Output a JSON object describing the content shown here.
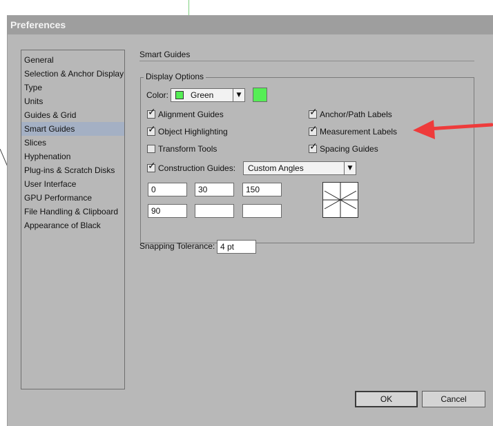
{
  "window": {
    "title": "Preferences"
  },
  "sidebar": {
    "items": [
      {
        "label": "General"
      },
      {
        "label": "Selection & Anchor Display"
      },
      {
        "label": "Type"
      },
      {
        "label": "Units"
      },
      {
        "label": "Guides & Grid"
      },
      {
        "label": "Smart Guides",
        "selected": true
      },
      {
        "label": "Slices"
      },
      {
        "label": "Hyphenation"
      },
      {
        "label": "Plug-ins & Scratch Disks"
      },
      {
        "label": "User Interface"
      },
      {
        "label": "GPU Performance"
      },
      {
        "label": "File Handling & Clipboard"
      },
      {
        "label": "Appearance of Black"
      }
    ]
  },
  "main": {
    "section_title": "Smart Guides",
    "display_options": {
      "legend": "Display Options",
      "color_label": "Color:",
      "color_value": "Green",
      "color_hex": "#55ee55",
      "checkboxes": {
        "alignment_guides": {
          "label": "Alignment Guides",
          "checked": true
        },
        "object_highlighting": {
          "label": "Object Highlighting",
          "checked": true
        },
        "transform_tools": {
          "label": "Transform Tools",
          "checked": false
        },
        "anchor_path_labels": {
          "label": "Anchor/Path Labels",
          "checked": true
        },
        "measurement_labels": {
          "label": "Measurement Labels",
          "checked": true
        },
        "spacing_guides": {
          "label": "Spacing Guides",
          "checked": true
        },
        "construction_guides": {
          "label": "Construction Guides:",
          "checked": true
        }
      },
      "construction_select_value": "Custom Angles",
      "angles": [
        "0",
        "30",
        "150",
        "90",
        "",
        ""
      ]
    },
    "snapping_tolerance": {
      "label": "Snapping Tolerance:",
      "value": "4 pt"
    }
  },
  "buttons": {
    "ok": "OK",
    "cancel": "Cancel"
  },
  "annotation": {
    "arrow_color": "#ee3b3b"
  }
}
